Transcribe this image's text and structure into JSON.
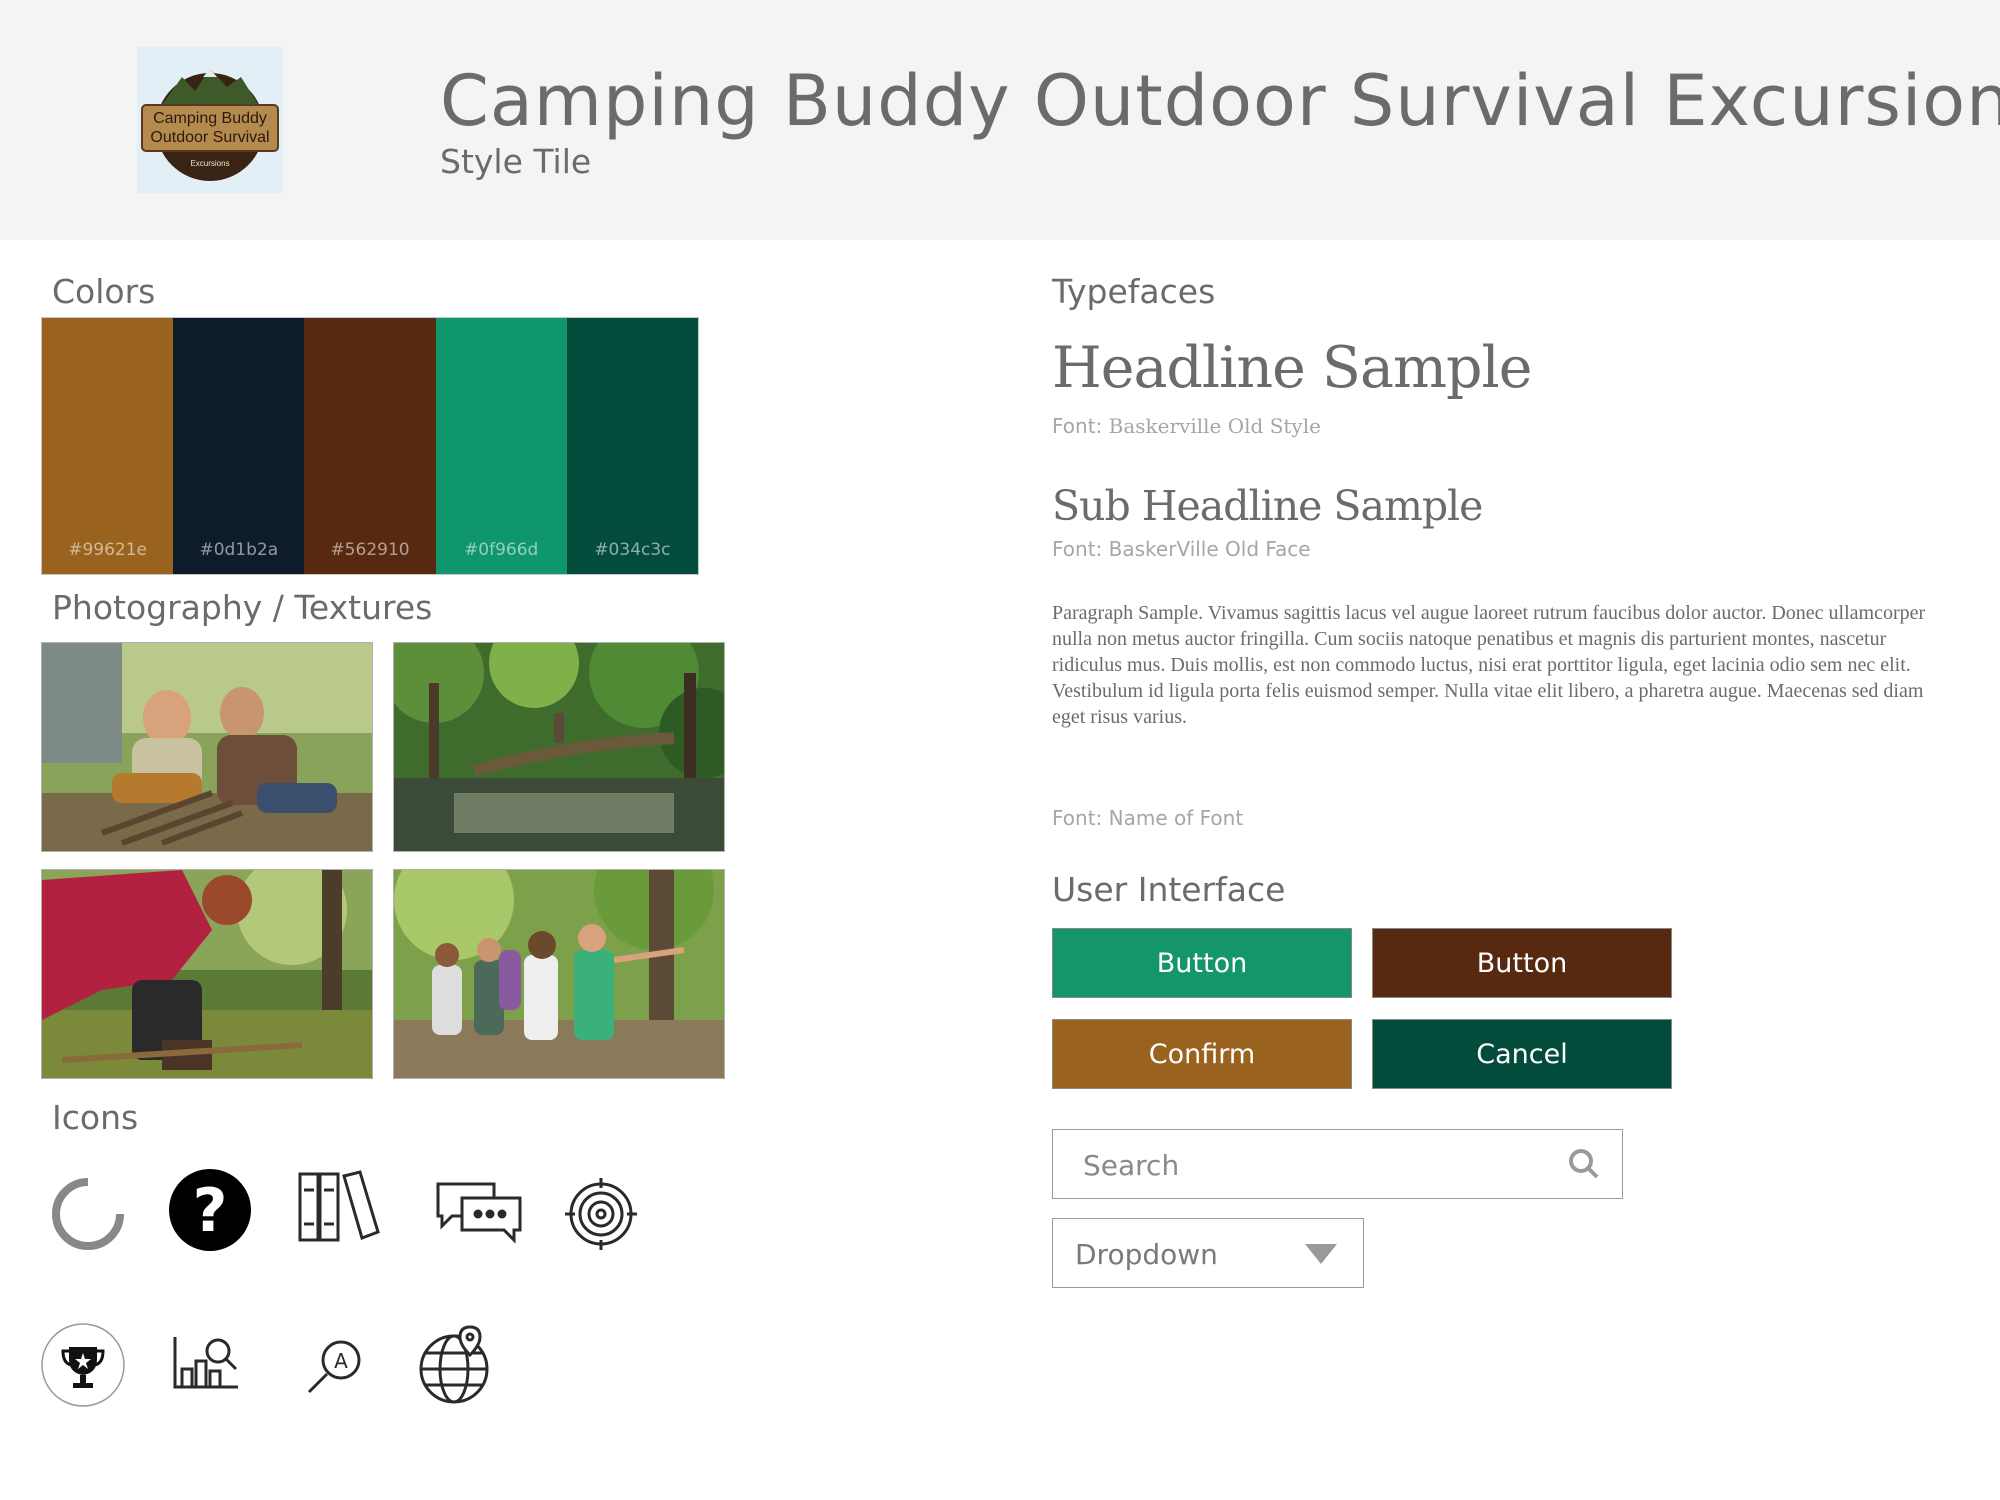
{
  "header": {
    "title": "Camping Buddy Outdoor Survival Excursions",
    "subtitle": "Style Tile",
    "logo": {
      "line1": "Camping Buddy",
      "line2": "Outdoor Survival",
      "line3": "Excursions"
    }
  },
  "colors": {
    "title": "Colors",
    "swatches": [
      {
        "hex": "#99621e",
        "label": "#99621e"
      },
      {
        "hex": "#0d1b2a",
        "label": "#0d1b2a"
      },
      {
        "hex": "#562910",
        "label": "#562910"
      },
      {
        "hex": "#0f966d",
        "label": "#0f966d"
      },
      {
        "hex": "#034c3c",
        "label": "#034c3c"
      }
    ]
  },
  "photography": {
    "title": "Photography / Textures",
    "photos": [
      {
        "name": "campers-building-fire-photo"
      },
      {
        "name": "forest-stream-photo"
      },
      {
        "name": "person-gathering-sticks-photo"
      },
      {
        "name": "hikers-in-woods-photo"
      }
    ]
  },
  "icons": {
    "title": "Icons",
    "items": [
      "loading-spinner-icon",
      "help-icon",
      "books-icon",
      "chat-icon",
      "target-icon",
      "trophy-icon",
      "chart-search-icon",
      "search-text-icon",
      "globe-location-icon"
    ]
  },
  "typefaces": {
    "title": "Typefaces",
    "headline": "Headline Sample",
    "headline_font_label": "Font:",
    "headline_font_value": "Baskerville Old Style",
    "subheadline": "Sub Headline Sample",
    "subheadline_font_label": "Font:",
    "subheadline_font_value": "BaskerVille Old Face",
    "paragraph": "Paragraph Sample. Vivamus sagittis lacus vel augue laoreet rutrum faucibus dolor auctor. Donec ullamcorper nulla non metus auctor fringilla. Cum sociis natoque penatibus et magnis dis parturient montes, nascetur ridiculus mus. Duis mollis, est non commodo luctus, nisi erat porttitor ligula, eget lacinia odio sem nec elit. Vestibulum id ligula porta felis euismod semper. Nulla vitae elit libero, a pharetra augue. Maecenas sed diam eget risus varius.",
    "paragraph_font": "Font: Name of Font"
  },
  "ui": {
    "title": "User Interface",
    "buttons": [
      {
        "label": "Button",
        "color": "#14956c"
      },
      {
        "label": "Button",
        "color": "#562910"
      },
      {
        "label": "Confirm",
        "color": "#99621e"
      },
      {
        "label": "Cancel",
        "color": "#034c3c"
      }
    ],
    "search_placeholder": "Search",
    "dropdown_label": "Dropdown"
  }
}
